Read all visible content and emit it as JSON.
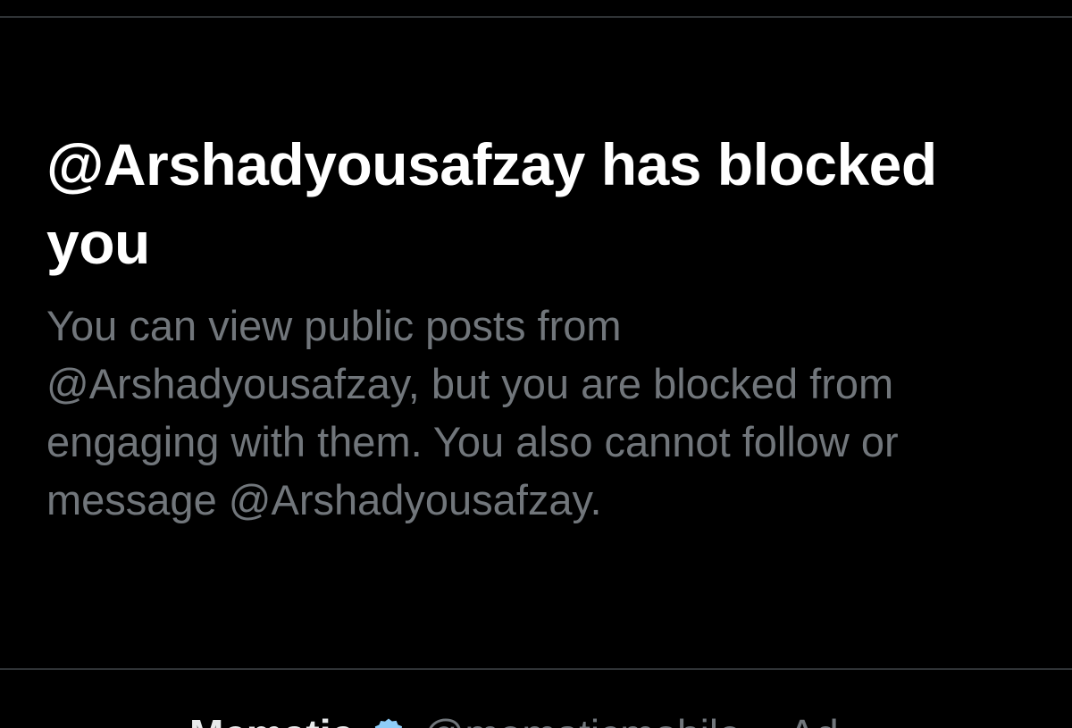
{
  "blocked_notice": {
    "title": "@Arshadyousafzay has blocked you",
    "body": "You can view public posts from @Arshadyousafzay, but you are blocked from engaging with them. You also cannot follow or message @Arshadyousafzay."
  },
  "post_preview": {
    "author_name": "Mematic",
    "author_handle": "@mematicmobile",
    "ad_label": "Ad",
    "verified_icon": "verified-badge-icon",
    "verified_color": "#8ecdf8"
  },
  "colors": {
    "background": "#000000",
    "title": "#ffffff",
    "body_text": "#71767b",
    "divider": "#2f3336"
  }
}
